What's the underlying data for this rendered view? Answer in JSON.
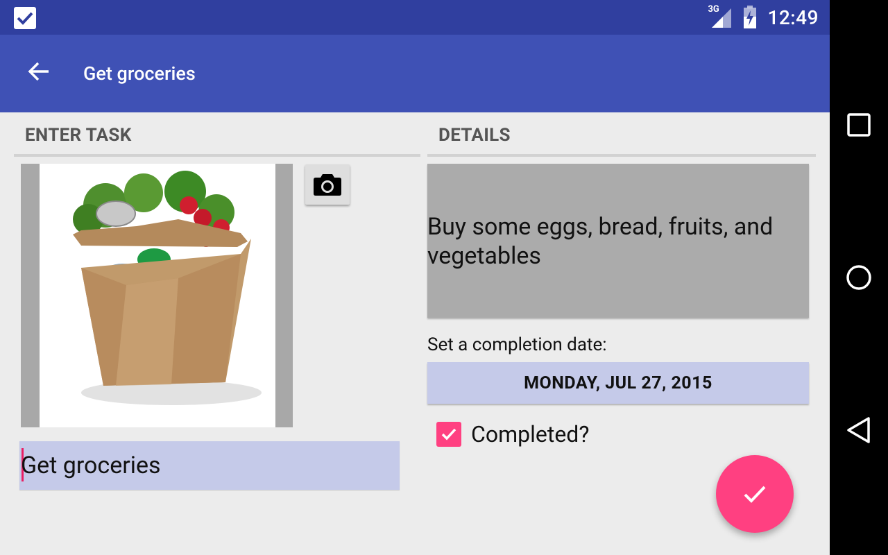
{
  "status_bar": {
    "time": "12:49",
    "network_label": "3G",
    "notification_icon": "check-box-icon",
    "colors": {
      "background": "#303f9f"
    }
  },
  "app_bar": {
    "title": "Get groceries",
    "back_icon": "arrow-back-icon",
    "colors": {
      "background": "#3f51b5"
    }
  },
  "enter_task": {
    "section_title": "ENTER TASK",
    "image_description": "grocery-bag-image",
    "camera_icon": "camera-icon",
    "task_title_value": "Get groceries"
  },
  "details": {
    "section_title": "DETAILS",
    "description_value": "Buy some eggs, bread, fruits, and vegetables",
    "completion_date_label": "Set a completion date:",
    "completion_date_value": "MONDAY, JUL 27, 2015",
    "completed_label": "Completed?",
    "completed_checked": true
  },
  "fab": {
    "icon": "check-icon",
    "color": "#ff4081"
  },
  "nav_bar": {
    "items": [
      "recent-apps-icon",
      "home-icon",
      "back-icon"
    ]
  },
  "colors": {
    "accent": "#ff4081",
    "field_background": "#c5cae9",
    "details_background": "#ababab"
  }
}
